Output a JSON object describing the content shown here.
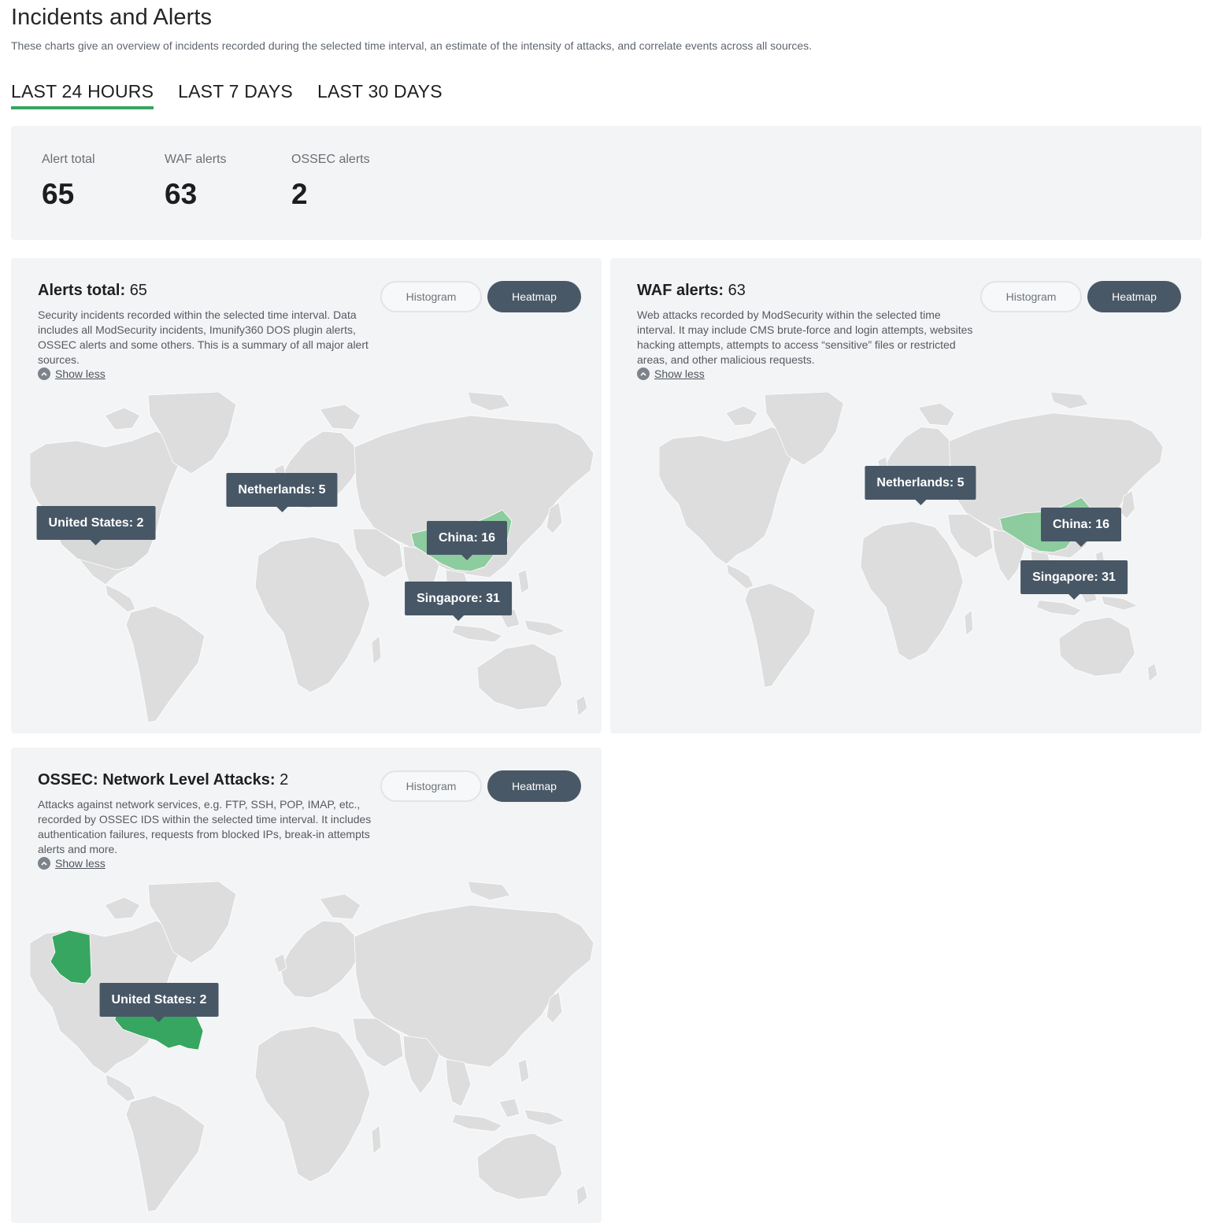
{
  "page": {
    "title": "Incidents and Alerts",
    "subtitle": "These charts give an overview of incidents recorded during the selected time interval, an estimate of the intensity of attacks, and correlate events across all sources."
  },
  "tabs": [
    {
      "label": "LAST 24 HOURS",
      "active": true
    },
    {
      "label": "LAST 7 DAYS",
      "active": false
    },
    {
      "label": "LAST 30 DAYS",
      "active": false
    }
  ],
  "summary": [
    {
      "label": "Alert total",
      "value": "65"
    },
    {
      "label": "WAF alerts",
      "value": "63"
    },
    {
      "label": "OSSEC alerts",
      "value": "2"
    }
  ],
  "toggle": {
    "histogram": "Histogram",
    "heatmap": "Heatmap",
    "active": "Heatmap"
  },
  "show_less": "Show less",
  "colors": {
    "land": "#dddddd",
    "highlight": "#36a660",
    "highlight_light": "#8ccc9e",
    "tooltip": "#485766",
    "tab_underline": "#36a660"
  },
  "cards": {
    "alerts_total": {
      "title": "Alerts total:",
      "count": "65",
      "description": "Security incidents recorded within the selected time interval. Data includes all ModSecurity incidents, Imunify360 DOS plugin alerts, OSSEC alerts and some others. This is a summary of all major alert sources.",
      "tooltips": [
        "United States: 2",
        "Netherlands: 5",
        "China: 16",
        "Singapore: 31"
      ]
    },
    "waf": {
      "title": "WAF alerts:",
      "count": "63",
      "description": "Web attacks recorded by ModSecurity within the selected time interval. It may include CMS brute-force and login attempts, websites hacking attempts, attempts to access “sensitive” files or restricted areas, and other malicious requests.",
      "tooltips": [
        "Netherlands: 5",
        "China: 16",
        "Singapore: 31"
      ]
    },
    "ossec": {
      "title": "OSSEC: Network Level Attacks:",
      "count": "2",
      "description": "Attacks against network services, e.g. FTP, SSH, POP, IMAP, etc., recorded by OSSEC IDS within the selected time interval. It includes authentication failures, requests from blocked IPs, break-in attempts alerts and more.",
      "tooltips": [
        "United States: 2"
      ]
    }
  }
}
